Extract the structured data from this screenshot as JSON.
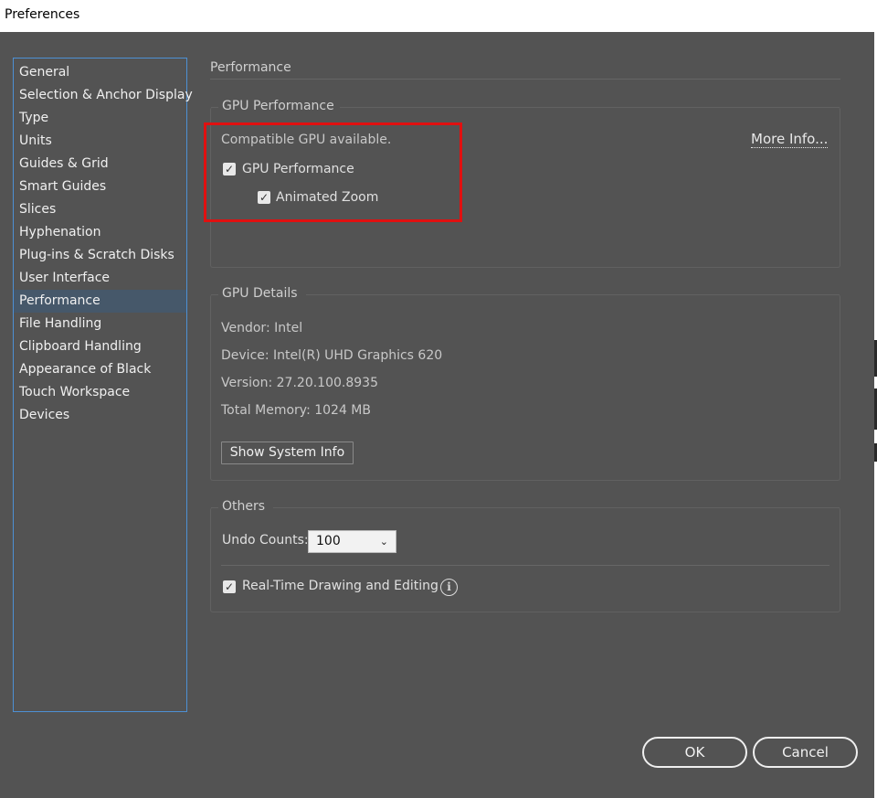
{
  "window": {
    "title": "Preferences"
  },
  "sidebar": {
    "items": [
      {
        "label": "General"
      },
      {
        "label": "Selection & Anchor Display"
      },
      {
        "label": "Type"
      },
      {
        "label": "Units"
      },
      {
        "label": "Guides & Grid"
      },
      {
        "label": "Smart Guides"
      },
      {
        "label": "Slices"
      },
      {
        "label": "Hyphenation"
      },
      {
        "label": "Plug-ins & Scratch Disks"
      },
      {
        "label": "User Interface"
      },
      {
        "label": "Performance",
        "selected": true
      },
      {
        "label": "File Handling"
      },
      {
        "label": "Clipboard Handling"
      },
      {
        "label": "Appearance of Black"
      },
      {
        "label": "Touch Workspace"
      },
      {
        "label": "Devices"
      }
    ]
  },
  "main": {
    "title": "Performance",
    "gpu_performance": {
      "legend": "GPU Performance",
      "status": "Compatible GPU available.",
      "more_info": "More Info...",
      "gpu_checkbox": {
        "label": "GPU Performance",
        "checked": true
      },
      "zoom_checkbox": {
        "label": "Animated Zoom",
        "checked": true
      }
    },
    "gpu_details": {
      "legend": "GPU Details",
      "vendor": "Vendor: Intel",
      "device": "Device: Intel(R) UHD Graphics 620",
      "version": "Version: 27.20.100.8935",
      "memory": "Total Memory: 1024 MB",
      "show_system_info": "Show System Info"
    },
    "others": {
      "legend": "Others",
      "undo_label": "Undo Counts:",
      "undo_value": "100",
      "realtime": {
        "label": "Real-Time Drawing and Editing",
        "checked": true
      }
    }
  },
  "buttons": {
    "ok": "OK",
    "cancel": "Cancel"
  },
  "colors": {
    "background": "#535353",
    "sidebar_border": "#4d90d4",
    "selected_item": "#46586a",
    "highlight": "#e01010"
  }
}
